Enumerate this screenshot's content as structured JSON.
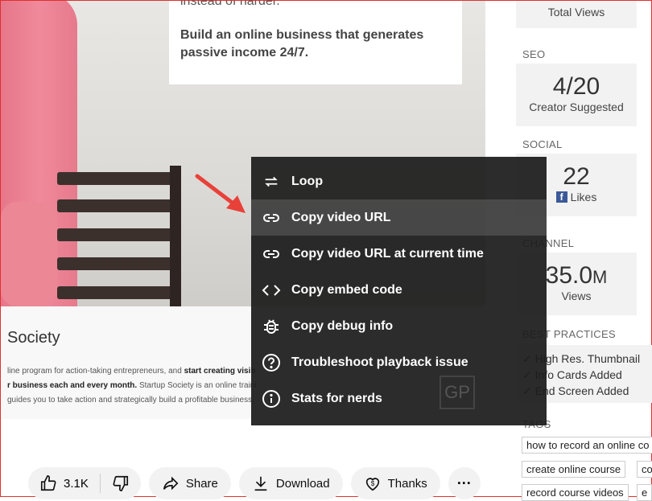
{
  "video": {
    "slide_top_text": "instead of harder.",
    "slide_main_text": "Build an online business that generates passive income 24/7.",
    "watermark": "GP"
  },
  "description": {
    "title": "Society",
    "line1_a": "line program for action-taking entrepreneurs, and ",
    "line1_b": "start creating visib",
    "line2_a": "r business each and every month.",
    "line2_b": " Startup Society is an online traini",
    "line3": "guides you to take action and strategically build a profitable business."
  },
  "actions": {
    "likes": "3.1K",
    "share": "Share",
    "download": "Download",
    "thanks": "Thanks"
  },
  "sidebar": {
    "total_views_label": "Total Views",
    "seo_label": "SEO",
    "seo_value": "4/20",
    "seo_sub": "Creator Suggested",
    "social_label": "SOCIAL",
    "social_value": "22",
    "social_sub": "Likes",
    "channel_label": "CHANNEL",
    "channel_value": "35.0",
    "channel_unit": "M",
    "channel_sub": "Views",
    "best_practices_label": "BEST PRACTICES",
    "best_practices": [
      "High Res. Thumbnail",
      "Info Cards Added",
      "End Screen Added"
    ],
    "tags_label": "TAGS",
    "tags": [
      "how to record an online co",
      "create online course",
      "co",
      "record course videos",
      "e"
    ]
  },
  "context_menu": {
    "items": [
      {
        "label": "Loop",
        "icon": "loop-icon"
      },
      {
        "label": "Copy video URL",
        "icon": "link-icon"
      },
      {
        "label": "Copy video URL at current time",
        "icon": "link-icon"
      },
      {
        "label": "Copy embed code",
        "icon": "code-icon"
      },
      {
        "label": "Copy debug info",
        "icon": "bug-icon"
      },
      {
        "label": "Troubleshoot playback issue",
        "icon": "help-icon"
      },
      {
        "label": "Stats for nerds",
        "icon": "info-icon"
      }
    ],
    "highlighted_index": 1
  },
  "colors": {
    "annotation_arrow": "#e8413a",
    "menu_bg": "#1c1c1c",
    "facebook": "#3b5998"
  }
}
